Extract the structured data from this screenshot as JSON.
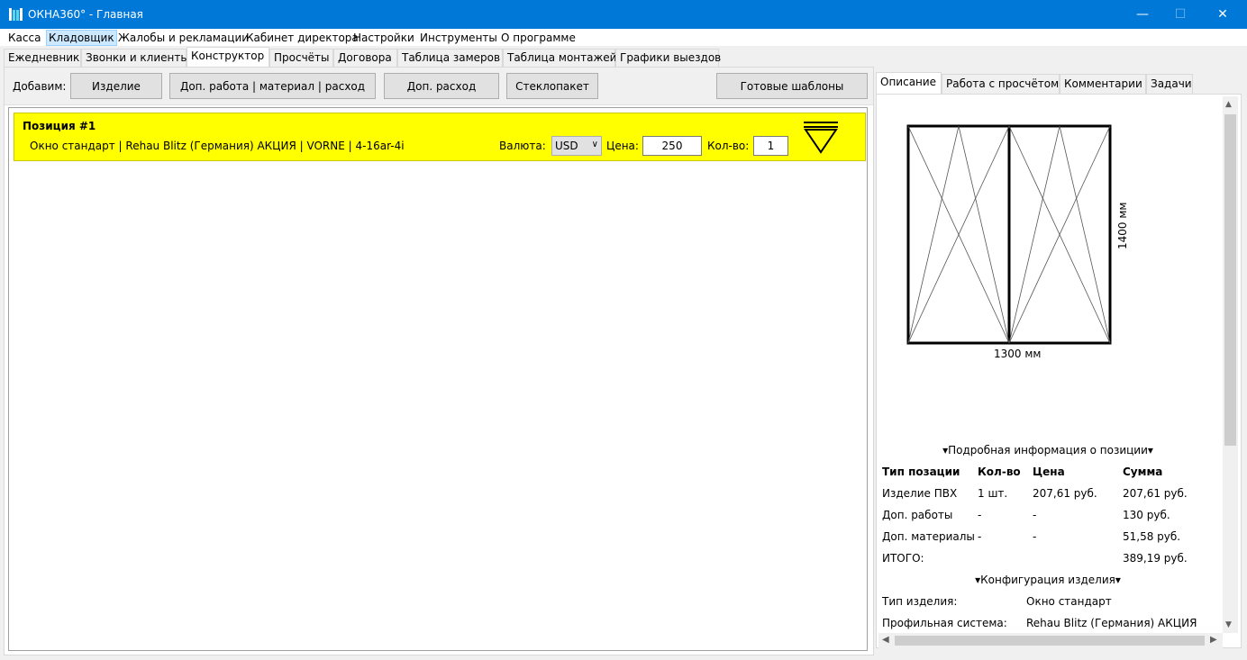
{
  "window": {
    "title": "ОКНА360° - Главная",
    "minimize": "—",
    "maximize": "☐",
    "close": "✕"
  },
  "menu": [
    "Касса",
    "Кладовщик",
    "Жалобы и рекламации",
    "Кабинет директора",
    "Настройки",
    "Инструменты",
    "О программе"
  ],
  "tabs": [
    "Ежедневник",
    "Звонки и клиенты",
    "Конструктор",
    "Просчёты",
    "Договора",
    "Таблица замеров",
    "Таблица монтажей",
    "Графики выездов"
  ],
  "toolbar": {
    "add_label": "Добавим:",
    "btn_product": "Изделие",
    "btn_extra_work": "Доп. работа | материал | расход",
    "btn_extra_cost": "Доп. расход",
    "btn_glass": "Стеклопакет",
    "btn_templates": "Готовые шаблоны"
  },
  "position": {
    "title": "Позиция #1",
    "description": "Окно стандарт | Rehau Blitz (Германия) АКЦИЯ | VORNE | 4-16ar-4i",
    "currency_label": "Валюта:",
    "currency": "USD",
    "price_label": "Цена:",
    "price": "250",
    "qty_label": "Кол-во:",
    "qty": "1"
  },
  "right_tabs": [
    "Описание",
    "Работа с просчётом",
    "Комментарии",
    "Задачи"
  ],
  "sketch": {
    "width_label": "1300 мм",
    "height_label": "1400 мм"
  },
  "details": {
    "section_title": "▾Подробная информация о позиции▾",
    "headers": [
      "Тип позации",
      "Кол-во",
      "Цена",
      "Сумма"
    ],
    "rows": [
      [
        "Изделие ПВХ",
        "1 шт.",
        "207,61 руб.",
        "207,61 руб."
      ],
      [
        "Доп. работы",
        "-",
        "-",
        "130 руб."
      ],
      [
        "Доп. материалы",
        "-",
        "-",
        "51,58 руб."
      ]
    ],
    "total_label": "ИТОГО:",
    "total": "389,19 руб."
  },
  "config": {
    "section_title": "▾Конфигурация изделия▾",
    "rows": [
      [
        "Тип изделия:",
        "Окно стандарт"
      ],
      [
        "Профильная система:",
        "Rehau Blitz (Германия) АКЦИЯ"
      ]
    ]
  }
}
